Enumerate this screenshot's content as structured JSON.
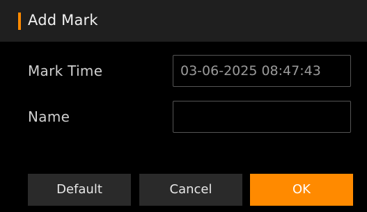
{
  "dialog": {
    "title": "Add Mark",
    "accent_color": "#ff8a00"
  },
  "form": {
    "mark_time_label": "Mark Time",
    "mark_time_value": "03-06-2025 08:47:43",
    "name_label": "Name",
    "name_value": ""
  },
  "buttons": {
    "default_label": "Default",
    "cancel_label": "Cancel",
    "ok_label": "OK"
  }
}
